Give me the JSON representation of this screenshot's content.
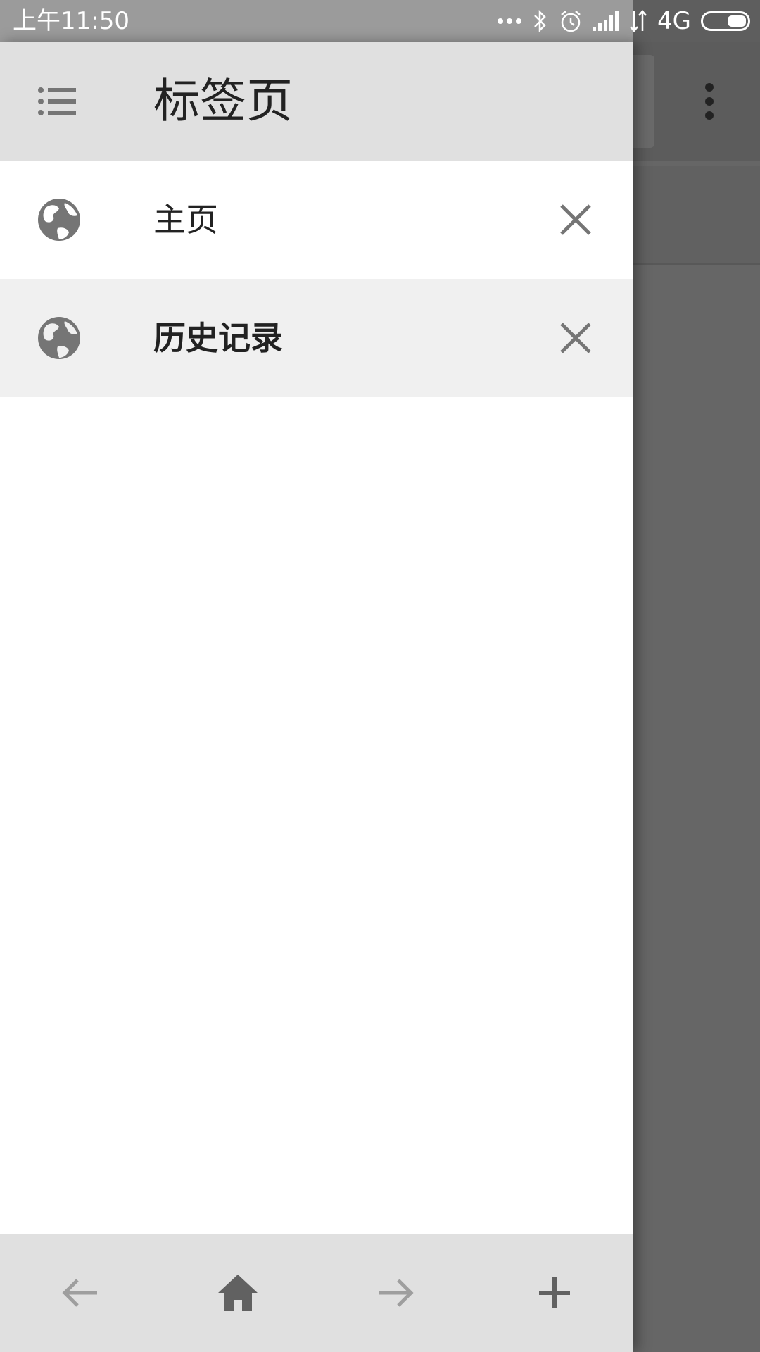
{
  "status_bar": {
    "time": "上午11:50",
    "network_label": "4G",
    "icons": [
      "more-dots-icon",
      "bluetooth-icon",
      "alarm-icon",
      "signal-icon",
      "data-arrows-icon",
      "battery-icon"
    ]
  },
  "drawer": {
    "title": "标签页",
    "header_icon": "list-icon",
    "tabs": [
      {
        "label": "主页",
        "icon": "globe-icon",
        "close_icon": "close-icon",
        "active": false
      },
      {
        "label": "历史记录",
        "icon": "globe-icon",
        "close_icon": "close-icon",
        "active": true
      }
    ],
    "bottom_bar": {
      "icons": [
        "back-arrow-icon",
        "home-icon",
        "forward-arrow-icon",
        "add-icon"
      ]
    }
  },
  "colors": {
    "drawer_header_bg": "#e0e0e0",
    "active_row_bg": "#f0f0f0",
    "icon_gray": "#757575",
    "scrim": "#666666"
  }
}
